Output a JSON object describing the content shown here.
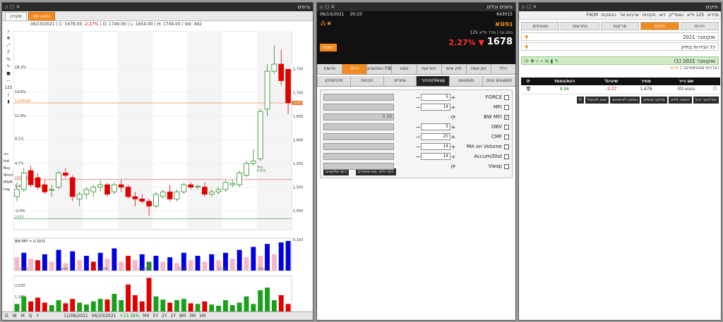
{
  "chart_panel": {
    "title": "גרפים",
    "tabs": [
      "סקירה",
      "נפטא יומי"
    ],
    "info": {
      "date": "06/10/2021",
      "close": "C: 1678.00",
      "change": "-2.27%",
      "open": "O: 1749.00",
      "low": "L: 1654.00",
      "high": "H: 1749.00",
      "vol": "Vol: 492"
    },
    "tools": [
      "⌕",
      "✥",
      "⤢",
      "F",
      "%",
      "✎",
      "■",
      "—",
      "125",
      "|",
      "▮"
    ],
    "indicator_labels": [
      "יומי",
      "Ind",
      "Buy",
      "Short",
      "M&M",
      "Log"
    ],
    "mfi_label": "BW MFI = 0.1931",
    "mfi_max": "0.1931",
    "buy_label": "Buy",
    "buy_pct": "6.93%",
    "bottom": {
      "periods": [
        "D",
        "W",
        "M",
        "Q",
        "Y"
      ],
      "from": "11/08/2021",
      "to": "06/10/2021",
      "gain": "+13.38%",
      "ranges": [
        "MX",
        "5Y",
        "2Y",
        "1Y",
        "6M",
        "3M",
        "1M"
      ]
    }
  },
  "chart_data": {
    "type": "candlestick",
    "price_ylim": [
      1410,
      1830
    ],
    "price_ticks": [
      {
        "v": 1750,
        "l": "1,750"
      },
      {
        "v": 1700,
        "l": "1,700"
      },
      {
        "v": 1650,
        "l": "1,650"
      },
      {
        "v": 1600,
        "l": "1,600"
      },
      {
        "v": 1550,
        "l": "1,550"
      },
      {
        "v": 1500,
        "l": "1,500"
      },
      {
        "v": 1450,
        "l": "1,450"
      }
    ],
    "pct_ticks": [
      {
        "v": 1754,
        "l": "18.2%"
      },
      {
        "v": 1702,
        "l": "14.8%"
      },
      {
        "v": 1651,
        "l": "11.6%"
      },
      {
        "v": 1603,
        "l": "8.1%"
      },
      {
        "v": 1551,
        "l": "4.7%"
      },
      {
        "v": 1502,
        "l": "1.4%"
      },
      {
        "v": 1450,
        "l": "-2.0%"
      }
    ],
    "hlines": [
      {
        "v": 1678,
        "l": "1,678.00",
        "color": "#e07a2a"
      },
      {
        "v": 1516,
        "l": "1516.00",
        "color": "#e05050"
      },
      {
        "v": 1433,
        "l": "1433",
        "color": "#3a9a3a"
      }
    ],
    "date_labels": [
      "12/08",
      "19/08",
      "26/08",
      "02/09",
      "09/09",
      "23/09",
      "30/09"
    ],
    "candles": [
      {
        "o": 1480,
        "h": 1510,
        "l": 1470,
        "c": 1495
      },
      {
        "o": 1495,
        "h": 1540,
        "l": 1490,
        "c": 1530
      },
      {
        "o": 1535,
        "h": 1545,
        "l": 1500,
        "c": 1505
      },
      {
        "o": 1520,
        "h": 1530,
        "l": 1495,
        "c": 1500
      },
      {
        "o": 1505,
        "h": 1515,
        "l": 1485,
        "c": 1490
      },
      {
        "o": 1495,
        "h": 1505,
        "l": 1480,
        "c": 1495
      },
      {
        "o": 1500,
        "h": 1535,
        "l": 1495,
        "c": 1530
      },
      {
        "o": 1530,
        "h": 1540,
        "l": 1520,
        "c": 1525
      },
      {
        "o": 1520,
        "h": 1525,
        "l": 1470,
        "c": 1480
      },
      {
        "o": 1475,
        "h": 1490,
        "l": 1460,
        "c": 1485
      },
      {
        "o": 1485,
        "h": 1500,
        "l": 1475,
        "c": 1495
      },
      {
        "o": 1490,
        "h": 1505,
        "l": 1480,
        "c": 1500
      },
      {
        "o": 1500,
        "h": 1515,
        "l": 1490,
        "c": 1505
      },
      {
        "o": 1505,
        "h": 1510,
        "l": 1480,
        "c": 1485
      },
      {
        "o": 1490,
        "h": 1510,
        "l": 1485,
        "c": 1505
      },
      {
        "o": 1505,
        "h": 1515,
        "l": 1490,
        "c": 1500
      },
      {
        "o": 1500,
        "h": 1505,
        "l": 1475,
        "c": 1480
      },
      {
        "o": 1480,
        "h": 1490,
        "l": 1460,
        "c": 1475
      },
      {
        "o": 1475,
        "h": 1485,
        "l": 1465,
        "c": 1470
      },
      {
        "o": 1470,
        "h": 1475,
        "l": 1440,
        "c": 1460
      },
      {
        "o": 1460,
        "h": 1490,
        "l": 1455,
        "c": 1485
      },
      {
        "o": 1480,
        "h": 1495,
        "l": 1475,
        "c": 1490
      },
      {
        "o": 1490,
        "h": 1505,
        "l": 1470,
        "c": 1475
      },
      {
        "o": 1475,
        "h": 1495,
        "l": 1470,
        "c": 1490
      },
      {
        "o": 1490,
        "h": 1510,
        "l": 1485,
        "c": 1505
      },
      {
        "o": 1505,
        "h": 1510,
        "l": 1495,
        "c": 1500
      },
      {
        "o": 1500,
        "h": 1505,
        "l": 1495,
        "c": 1502
      },
      {
        "o": 1500,
        "h": 1510,
        "l": 1480,
        "c": 1485
      },
      {
        "o": 1485,
        "h": 1495,
        "l": 1480,
        "c": 1490
      },
      {
        "o": 1490,
        "h": 1500,
        "l": 1485,
        "c": 1495
      },
      {
        "o": 1495,
        "h": 1515,
        "l": 1490,
        "c": 1510
      },
      {
        "o": 1505,
        "h": 1515,
        "l": 1500,
        "c": 1508
      },
      {
        "o": 1505,
        "h": 1535,
        "l": 1500,
        "c": 1530
      },
      {
        "o": 1525,
        "h": 1555,
        "l": 1520,
        "c": 1550
      },
      {
        "o": 1550,
        "h": 1580,
        "l": 1545,
        "c": 1555
      },
      {
        "o": 1560,
        "h": 1665,
        "l": 1555,
        "c": 1660
      },
      {
        "o": 1665,
        "h": 1760,
        "l": 1650,
        "c": 1745
      },
      {
        "o": 1745,
        "h": 1800,
        "l": 1740,
        "c": 1760
      },
      {
        "o": 1760,
        "h": 1790,
        "l": 1715,
        "c": 1725
      },
      {
        "o": 1749,
        "h": 1749,
        "l": 1654,
        "c": 1678
      }
    ],
    "mfi": [
      {
        "h": 0.45,
        "c": "p"
      },
      {
        "h": 0.6,
        "c": "b"
      },
      {
        "h": 0.4,
        "c": "p"
      },
      {
        "h": 0.35,
        "c": "r"
      },
      {
        "h": 0.55,
        "c": "b"
      },
      {
        "h": 0.3,
        "c": "p"
      },
      {
        "h": 0.7,
        "c": "b"
      },
      {
        "h": 0.25,
        "c": "p"
      },
      {
        "h": 0.65,
        "c": "b"
      },
      {
        "h": 0.35,
        "c": "p"
      },
      {
        "h": 0.5,
        "c": "b"
      },
      {
        "h": 0.3,
        "c": "r"
      },
      {
        "h": 0.6,
        "c": "b"
      },
      {
        "h": 0.4,
        "c": "p"
      },
      {
        "h": 0.75,
        "c": "b"
      },
      {
        "h": 0.3,
        "c": "p"
      },
      {
        "h": 0.5,
        "c": "r"
      },
      {
        "h": 0.35,
        "c": "p"
      },
      {
        "h": 0.55,
        "c": "b"
      },
      {
        "h": 0.3,
        "c": "g"
      },
      {
        "h": 0.5,
        "c": "b"
      },
      {
        "h": 0.3,
        "c": "p"
      },
      {
        "h": 0.45,
        "c": "b"
      },
      {
        "h": 0.25,
        "c": "p"
      },
      {
        "h": 0.6,
        "c": "b"
      },
      {
        "h": 0.35,
        "c": "p"
      },
      {
        "h": 0.5,
        "c": "b"
      },
      {
        "h": 0.3,
        "c": "p"
      },
      {
        "h": 0.55,
        "c": "b"
      },
      {
        "h": 0.35,
        "c": "p"
      },
      {
        "h": 0.6,
        "c": "b"
      },
      {
        "h": 0.4,
        "c": "p"
      },
      {
        "h": 0.7,
        "c": "b"
      },
      {
        "h": 0.45,
        "c": "p"
      },
      {
        "h": 0.8,
        "c": "b"
      },
      {
        "h": 0.5,
        "c": "p"
      },
      {
        "h": 0.9,
        "c": "b"
      },
      {
        "h": 0.55,
        "c": "p"
      },
      {
        "h": 0.95,
        "c": "b"
      },
      {
        "h": 1.0,
        "c": "b"
      }
    ],
    "vol_ticks": [
      {
        "v": 2070,
        "l": "2,070"
      },
      {
        "v": 1180,
        "l": "1,180"
      }
    ],
    "vol_max": 2700,
    "volume": [
      {
        "v": 600,
        "c": "g"
      },
      {
        "v": 1200,
        "c": "g"
      },
      {
        "v": 800,
        "c": "r"
      },
      {
        "v": 1100,
        "c": "r"
      },
      {
        "v": 700,
        "c": "r"
      },
      {
        "v": 500,
        "c": "g"
      },
      {
        "v": 900,
        "c": "g"
      },
      {
        "v": 650,
        "c": "r"
      },
      {
        "v": 1000,
        "c": "r"
      },
      {
        "v": 700,
        "c": "g"
      },
      {
        "v": 550,
        "c": "g"
      },
      {
        "v": 800,
        "c": "g"
      },
      {
        "v": 1000,
        "c": "g"
      },
      {
        "v": 950,
        "c": "r"
      },
      {
        "v": 1400,
        "c": "g"
      },
      {
        "v": 900,
        "c": "g"
      },
      {
        "v": 2150,
        "c": "r"
      },
      {
        "v": 1300,
        "c": "r"
      },
      {
        "v": 800,
        "c": "r"
      },
      {
        "v": 2680,
        "c": "r"
      },
      {
        "v": 1200,
        "c": "g"
      },
      {
        "v": 950,
        "c": "g"
      },
      {
        "v": 700,
        "c": "r"
      },
      {
        "v": 900,
        "c": "g"
      },
      {
        "v": 1000,
        "c": "g"
      },
      {
        "v": 650,
        "c": "r"
      },
      {
        "v": 600,
        "c": "g"
      },
      {
        "v": 800,
        "c": "r"
      },
      {
        "v": 550,
        "c": "g"
      },
      {
        "v": 450,
        "c": "g"
      },
      {
        "v": 900,
        "c": "g"
      },
      {
        "v": 500,
        "c": "g"
      },
      {
        "v": 700,
        "c": "g"
      },
      {
        "v": 1200,
        "c": "g"
      },
      {
        "v": 600,
        "c": "g"
      },
      {
        "v": 1700,
        "c": "g"
      },
      {
        "v": 1900,
        "c": "g"
      },
      {
        "v": 900,
        "c": "g"
      },
      {
        "v": 1300,
        "c": "r"
      },
      {
        "v": 600,
        "c": "r"
      }
    ]
  },
  "analysis_panel": {
    "title": "נתונים וכלים",
    "date": "06/10/2021",
    "time": "20:33",
    "code": "643015",
    "name": "נפטא",
    "sub": "נפט וגז | מדד ת\"א 125",
    "price": "1678",
    "change": "2.27%",
    "trade": "ביצוע",
    "tabs1": [
      "חדשות",
      "כלים",
      "המחשבון FIB",
      "טסט",
      "התראות",
      "תיק אישי",
      "זמן אמת",
      "כללי"
    ],
    "tabs2": [
      "סיכוי/סיכון",
      "תבניות",
      "אחרים",
      "מחזור/Vwap",
      "מומנטום",
      "ממוצעים נעים"
    ],
    "indicators": [
      {
        "label": "FORCE",
        "value": "5",
        "bar": "",
        "checked": false,
        "stepper": true
      },
      {
        "label": "MFI",
        "value": "14",
        "bar": "",
        "checked": false,
        "stepper": true
      },
      {
        "label": "BW MFI",
        "value": "",
        "bar": "0.19",
        "checked": true,
        "stepper": false
      },
      {
        "label": "OBV",
        "value": "5",
        "bar": "",
        "checked": false,
        "stepper": true
      },
      {
        "label": "CMF",
        "value": "20",
        "bar": "",
        "checked": false,
        "stepper": true
      },
      {
        "label": "MA on Volume",
        "value": "14",
        "bar": "",
        "checked": false,
        "stepper": true
      },
      {
        "label": "Accum/Dist",
        "value": "14",
        "bar": "",
        "checked": false,
        "stepper": true
      },
      {
        "label": "Vwap",
        "value": "",
        "bar": "",
        "checked": false,
        "stepper": false
      }
    ],
    "buttons": [
      "ניקוי שלוקטים",
      "איפוס מתנודים",
      "ניקוי כלים"
    ]
  },
  "portfolio_panel": {
    "title": "תיקים",
    "topbar": [
      "מדדים",
      "125 ת\"א",
      "נאסד\"ק",
      "דאו",
      "פקודות",
      "ארביטראז'",
      "הבסקית",
      "FXCM"
    ],
    "tabs": [
      "מועדפים",
      "התראות",
      "סריקות",
      "תיקים",
      "ניירות"
    ],
    "select1": "אוקטובר 2021",
    "select2": "כל הניירות בתיק",
    "pf_name": "אוקטובר 2021",
    "pf_count": "(1)",
    "links": [
      "הגדרות",
      "סטטיסטיקה"
    ],
    "link_new": "חדש",
    "columns": [
      "שם נייר",
      "מחיר",
      "%שינוי",
      "רווח/הפסד"
    ],
    "rows": [
      {
        "name": "נפטא (0)",
        "price": "1,678",
        "change": "-2.27",
        "pl": "8.96"
      }
    ],
    "buttons": [
      "בחר/הסר הכל",
      "הוספה לתיק",
      "מחיקה מהתיק",
      "הוספה לא-מיינים",
      "ייצוא לאקסל",
      "⟳"
    ]
  }
}
